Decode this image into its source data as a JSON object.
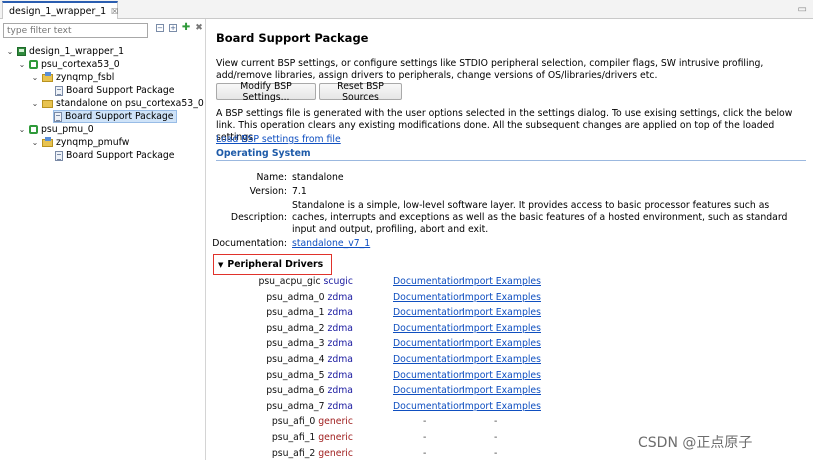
{
  "tab": {
    "title": "design_1_wrapper_1",
    "close": "☒"
  },
  "filter": {
    "placeholder": "type filter text"
  },
  "tree": {
    "root": "design_1_wrapper_1",
    "cpu0": "psu_cortexa53_0",
    "fsbl": "zynqmp_fsbl",
    "fsbl_bsp": "Board Support Package",
    "standalone": "standalone on psu_cortexa53_0",
    "standalone_bsp": "Board Support Package",
    "pmu": "psu_pmu_0",
    "pmufw": "zynqmp_pmufw",
    "pmufw_bsp": "Board Support Package"
  },
  "main": {
    "title": "Board Support Package",
    "description": "View current BSP settings, or configure settings like STDIO peripheral selection, compiler flags, SW intrusive profiling, add/remove libraries, assign drivers to peripherals, change versions of OS/libraries/drivers etc.",
    "modify_button": "Modify BSP Settings...",
    "reset_button": "Reset BSP Sources",
    "settings_note": "A BSP settings file is generated with the user options selected in the settings dialog. To use exising settings, click the below link. This operation clears any existing modifications done. All the subsequent changes are applied on top of the loaded settings.",
    "load_link": "Load BSP settings from file",
    "os_section": "Operating System",
    "os": {
      "name_label": "Name:",
      "name": "standalone",
      "version_label": "Version:",
      "version": "7.1",
      "description_label": "Description:",
      "description": "Standalone is a simple, low-level software layer. It provides access to basic processor features such as caches, interrupts and exceptions as well as the basic features of a hosted environment, such as standard input and output, profiling, abort and exit.",
      "documentation_label": "Documentation:",
      "documentation_link": "standalone_v7_1"
    },
    "peripheral_section": "Peripheral Drivers",
    "doc_link": "Documentation",
    "import_link": "Import Examples",
    "dash": "-",
    "drivers": [
      {
        "name": "psu_acpu_gic",
        "driver": "scugic"
      },
      {
        "name": "psu_adma_0",
        "driver": "zdma"
      },
      {
        "name": "psu_adma_1",
        "driver": "zdma"
      },
      {
        "name": "psu_adma_2",
        "driver": "zdma"
      },
      {
        "name": "psu_adma_3",
        "driver": "zdma"
      },
      {
        "name": "psu_adma_4",
        "driver": "zdma"
      },
      {
        "name": "psu_adma_5",
        "driver": "zdma"
      },
      {
        "name": "psu_adma_6",
        "driver": "zdma"
      },
      {
        "name": "psu_adma_7",
        "driver": "zdma"
      },
      {
        "name": "psu_afi_0",
        "driver": "generic"
      },
      {
        "name": "psu_afi_1",
        "driver": "generic"
      },
      {
        "name": "psu_afi_2",
        "driver": "generic"
      }
    ]
  },
  "watermark": "CSDN @正点原子",
  "colors": {
    "link": "#0f4fc0",
    "section": "#1d5aa8",
    "highlight_box": "#e0322b",
    "selection": "#cfe3f8"
  }
}
